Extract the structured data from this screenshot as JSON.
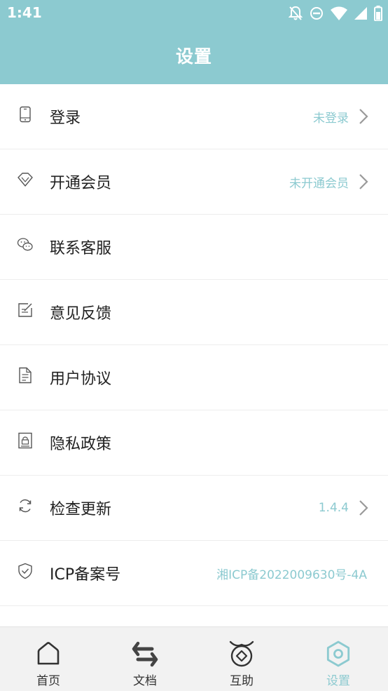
{
  "status_bar": {
    "time": "1:41",
    "icons": [
      "bell-off-icon",
      "do-not-disturb-icon",
      "wifi-icon",
      "signal-icon",
      "battery-icon"
    ]
  },
  "header": {
    "title": "设置"
  },
  "settings": {
    "items": [
      {
        "label": "登录",
        "value": "未登录",
        "icon": "phone-icon",
        "has_arrow": true
      },
      {
        "label": "开通会员",
        "value": "未开通会员",
        "icon": "diamond-icon",
        "has_arrow": true
      },
      {
        "label": "联系客服",
        "value": "",
        "icon": "wechat-icon",
        "has_arrow": false
      },
      {
        "label": "意见反馈",
        "value": "",
        "icon": "edit-icon",
        "has_arrow": false
      },
      {
        "label": "用户协议",
        "value": "",
        "icon": "document-icon",
        "has_arrow": false
      },
      {
        "label": "隐私政策",
        "value": "",
        "icon": "lock-document-icon",
        "has_arrow": false
      },
      {
        "label": "检查更新",
        "value": "1.4.4",
        "icon": "refresh-icon",
        "has_arrow": true
      },
      {
        "label": "ICP备案号",
        "value": "湘ICP备2022009630号-4A",
        "icon": "shield-check-icon",
        "has_arrow": false
      }
    ]
  },
  "tab_bar": {
    "tabs": [
      {
        "label": "首页",
        "icon": "home-icon",
        "active": false
      },
      {
        "label": "文档",
        "icon": "swap-arrows-icon",
        "active": false
      },
      {
        "label": "互助",
        "icon": "coin-pouch-icon",
        "active": false
      },
      {
        "label": "设置",
        "icon": "hexagon-settings-icon",
        "active": true
      }
    ]
  },
  "colors": {
    "accent": "#8ccad0",
    "text": "#222222",
    "divider": "#ededed",
    "tab_bar_bg": "#f2f2f2"
  }
}
